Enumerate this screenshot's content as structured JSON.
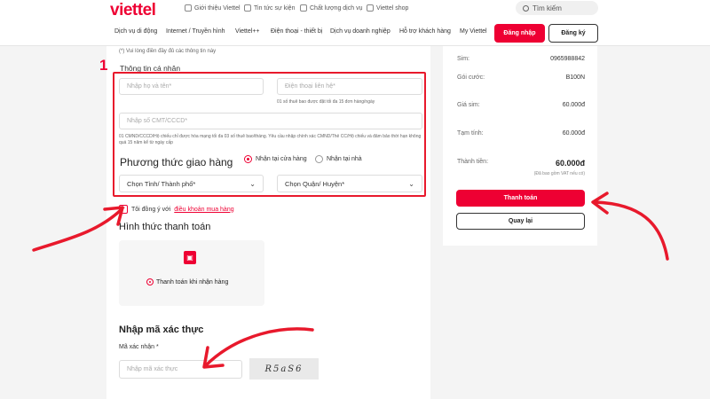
{
  "brand": {
    "logo": "viettel",
    "accent": "#ee0033",
    "annotation_color": "#e8192c"
  },
  "topbar": {
    "links": [
      {
        "label": "Giới thiệu Viettel",
        "icon": "globe-icon"
      },
      {
        "label": "Tin tức sự kiện",
        "icon": "news-icon"
      },
      {
        "label": "Chất lượng dịch vụ",
        "icon": "quality-icon"
      },
      {
        "label": "Viettel shop",
        "icon": "shop-icon"
      }
    ],
    "search_placeholder": "Tìm kiếm"
  },
  "nav": {
    "items": [
      "Dịch vụ di động",
      "Internet / Truyền hình",
      "Viettel++",
      "Điện thoại - thiết bị",
      "Dịch vụ doanh nghiệp",
      "Hỗ trợ khách hàng",
      "My Viettel"
    ],
    "login": "Đăng nhập",
    "register": "Đăng ký"
  },
  "form": {
    "required_hint": "(*) Vui lòng điền đầy đủ các thông tin này",
    "annotation_number": "1",
    "personal_title": "Thông tin cá nhân",
    "name_placeholder": "Nhập họ và tên*",
    "phone_placeholder": "Điện thoại liên hệ*",
    "phone_note": "01 số thuê bao được đặt tối đa 15 đơn hàng/ngày",
    "id_placeholder": "Nhập số CMT/CCCD*",
    "id_note": "01 CMND/CCCD/Hộ chiếu chỉ được hòa mạng tối đa 03 số thuê bao/tháng. Yêu cầu nhập chính xác CMND/Thẻ CC/Hộ chiếu và đảm bảo thời hạn không quá 15 năm kể từ ngày cấp",
    "shipping_title": "Phương thức giao hàng",
    "shipping_options": [
      {
        "label": "Nhận tại cửa hàng",
        "selected": true
      },
      {
        "label": "Nhận tại nhà",
        "selected": false
      }
    ],
    "province_select": "Chọn Tỉnh/ Thành phố*",
    "district_select": "Chọn Quận/ Huyện*",
    "agree_text": "Tôi đồng ý với",
    "agree_link": "điều khoản mua hàng",
    "agree_checked": true
  },
  "payment": {
    "title": "Hình thức thanh toán",
    "method_label": "Thanh toán khi nhận hàng",
    "method_icon": "shopping-bag-icon"
  },
  "verify": {
    "title": "Nhập mã xác thực",
    "label": "Mã xác nhận *",
    "placeholder": "Nhập mã xác thực",
    "captcha_text": "R5aS6"
  },
  "summary": {
    "rows": [
      {
        "key": "Sim:",
        "value": "0965988842"
      },
      {
        "key": "Gói cước:",
        "value": "B100N"
      },
      {
        "key": "Giá sim:",
        "value": "60.000đ"
      },
      {
        "key": "Tạm tính:",
        "value": "60.000đ"
      },
      {
        "key": "Thành tiền:",
        "value": "60.000đ"
      }
    ],
    "vat_note": "(Đã bao gồm VAT nếu có)",
    "pay_button": "Thanh toán",
    "back_button": "Quay lại"
  }
}
